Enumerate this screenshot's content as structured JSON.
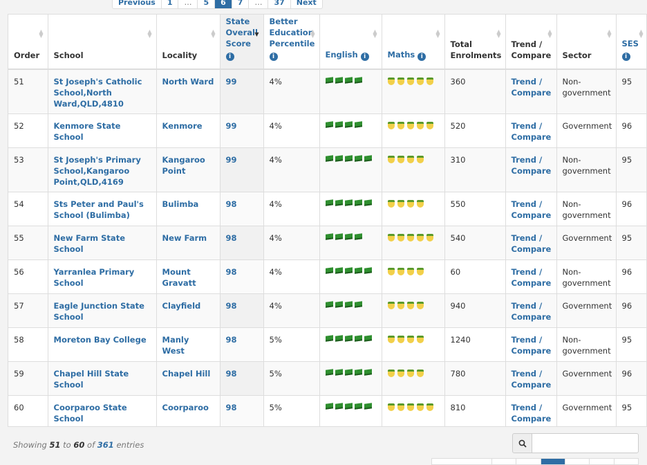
{
  "pagination_top": {
    "previous": "Previous",
    "pages": [
      "1",
      "…",
      "5",
      "6",
      "7",
      "…",
      "37"
    ],
    "active_page": "6",
    "next": "Next"
  },
  "columns": {
    "order": "Order",
    "school": "School",
    "locality": "Locality",
    "state_score": "State Overall Score",
    "percentile": "Better Education Percentile",
    "english": "English",
    "maths": "Maths",
    "enrolments": "Total Enrolments",
    "trend": "Trend / Compare",
    "sector": "Sector",
    "ses": "SES"
  },
  "rows": [
    {
      "order": "51",
      "school": "St Joseph's Catholic School,North Ward,QLD,4810",
      "locality": "North Ward",
      "score": "99",
      "percentile": "4%",
      "english": 4,
      "maths": 5,
      "enrolments": "360",
      "trend": "Trend / Compare",
      "sector": "Non-government",
      "ses": "95"
    },
    {
      "order": "52",
      "school": "Kenmore State School",
      "locality": "Kenmore",
      "score": "99",
      "percentile": "4%",
      "english": 4,
      "maths": 5,
      "enrolments": "520",
      "trend": "Trend / Compare",
      "sector": "Government",
      "ses": "96"
    },
    {
      "order": "53",
      "school": "St Joseph's Primary School,Kangaroo Point,QLD,4169",
      "locality": "Kangaroo Point",
      "score": "99",
      "percentile": "4%",
      "english": 5,
      "maths": 4,
      "enrolments": "310",
      "trend": "Trend / Compare",
      "sector": "Non-government",
      "ses": "95"
    },
    {
      "order": "54",
      "school": "Sts Peter and Paul's School (Bulimba)",
      "locality": "Bulimba",
      "score": "98",
      "percentile": "4%",
      "english": 5,
      "maths": 4,
      "enrolments": "550",
      "trend": "Trend / Compare",
      "sector": "Non-government",
      "ses": "96"
    },
    {
      "order": "55",
      "school": "New Farm State School",
      "locality": "New Farm",
      "score": "98",
      "percentile": "4%",
      "english": 4,
      "maths": 5,
      "enrolments": "540",
      "trend": "Trend / Compare",
      "sector": "Government",
      "ses": "95"
    },
    {
      "order": "56",
      "school": "Yarranlea Primary School",
      "locality": "Mount Gravatt",
      "score": "98",
      "percentile": "4%",
      "english": 5,
      "maths": 4,
      "enrolments": "60",
      "trend": "Trend / Compare",
      "sector": "Non-government",
      "ses": "96"
    },
    {
      "order": "57",
      "school": "Eagle Junction State School",
      "locality": "Clayfield",
      "score": "98",
      "percentile": "4%",
      "english": 4,
      "maths": 4,
      "enrolments": "940",
      "trend": "Trend / Compare",
      "sector": "Government",
      "ses": "96"
    },
    {
      "order": "58",
      "school": "Moreton Bay College",
      "locality": "Manly West",
      "score": "98",
      "percentile": "5%",
      "english": 5,
      "maths": 4,
      "enrolments": "1240",
      "trend": "Trend / Compare",
      "sector": "Non-government",
      "ses": "95"
    },
    {
      "order": "59",
      "school": "Chapel Hill State School",
      "locality": "Chapel Hill",
      "score": "98",
      "percentile": "5%",
      "english": 5,
      "maths": 4,
      "enrolments": "780",
      "trend": "Trend / Compare",
      "sector": "Government",
      "ses": "96"
    },
    {
      "order": "60",
      "school": "Coorparoo State School",
      "locality": "Coorparoo",
      "score": "98",
      "percentile": "5%",
      "english": 5,
      "maths": 5,
      "enrolments": "810",
      "trend": "Trend / Compare",
      "sector": "Government",
      "ses": "95"
    }
  ],
  "footer": {
    "showing": "Showing",
    "from": "51",
    "to_word": "to",
    "to": "60",
    "of_word": "of",
    "total": "361",
    "entries": "entries"
  },
  "search": {
    "placeholder": ""
  },
  "icons": {
    "info": "info-icon",
    "english": "book-icon",
    "maths": "apple-icon",
    "search": "search-icon"
  },
  "colors": {
    "link": "#2e6da4",
    "active_page": "#2e6da4",
    "book": "#2f8f2f",
    "apple": "#f2d04a"
  }
}
